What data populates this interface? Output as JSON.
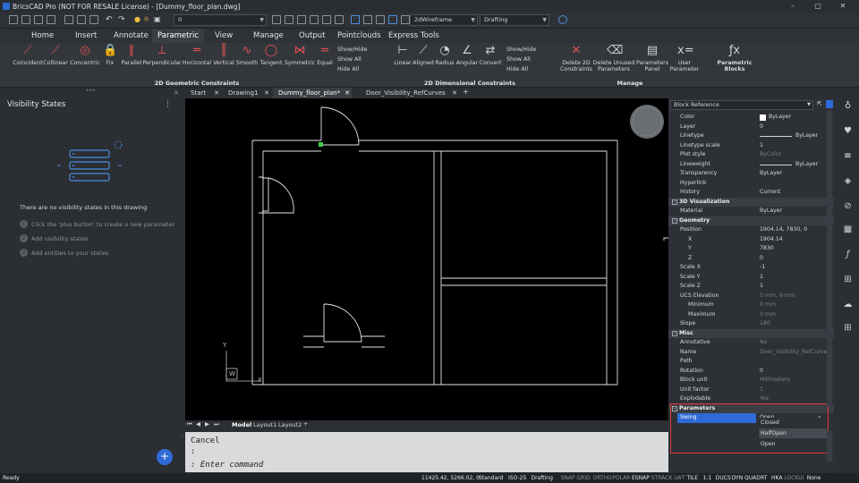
{
  "window": {
    "title": "BricsCAD Pro (NOT FOR RESALE License) - [Dummy_floor_plan.dwg]",
    "min": "–",
    "max": "▢",
    "close": "✕"
  },
  "quick": {
    "layer_value": "0",
    "visual_style": "2dWireframe",
    "workspace": "Drafting"
  },
  "menu_tabs": [
    "Home",
    "Insert",
    "Annotate",
    "Parametric",
    "View",
    "Manage",
    "Output",
    "Pointclouds",
    "Express Tools"
  ],
  "ribbon": {
    "geometric": [
      "Coincident",
      "Collinear",
      "Concentric",
      "Fix",
      "Parallel",
      "Perpendicular",
      "Horizontal",
      "Vertical",
      "Smooth",
      "Tangent",
      "Symmetric",
      "Equal"
    ],
    "geo_small": [
      "Show/Hide",
      "Show All",
      "Hide All"
    ],
    "dimensional": [
      "Linear",
      "Aligned",
      "Radius",
      "Angular",
      "Convert"
    ],
    "dim_small": [
      "Show/Hide",
      "Show All",
      "Hide All"
    ],
    "manage": [
      "Delete 2D Constraints",
      "Delete Unused Parameters",
      "Parameters Panel",
      "User Parameter"
    ],
    "blocks": "Parametric Blocks",
    "group_geo": "2D Geometric Constraints",
    "group_dim": "2D Dimensional Constraints",
    "group_manage": "Manage"
  },
  "left_panel": {
    "title": "Visibility States",
    "empty": "There are no visibility states in this drawing",
    "steps": [
      "Click the 'plus button' to create a new parameter",
      "Add visibility states",
      "Add entities to your states"
    ]
  },
  "doc_tabs": [
    "Start",
    "Drawing1",
    "Dummy_floor_plan*",
    "Door_Visibility_RefCurves"
  ],
  "layout_tabs": [
    "Model",
    "Layout1",
    "Layout2"
  ],
  "viewport": {
    "ucs_x": "X",
    "ucs_y": "Y",
    "ucs_w": "W"
  },
  "command": {
    "history": "Cancel",
    "prompt": ":",
    "input": ": Enter command"
  },
  "props": {
    "selector": "Block Reference",
    "rows": [
      {
        "k": "Color",
        "v": "ByLayer"
      },
      {
        "k": "Layer",
        "v": "0"
      },
      {
        "k": "Linetype",
        "v": "ByLayer"
      },
      {
        "k": "Linetype scale",
        "v": "1"
      },
      {
        "k": "Plot style",
        "v": "ByColor"
      },
      {
        "k": "Lineweight",
        "v": "ByLayer"
      },
      {
        "k": "Transparency",
        "v": "ByLayer"
      },
      {
        "k": "Hyperlink",
        "v": ""
      },
      {
        "k": "History",
        "v": "Current"
      },
      {
        "k": "3D Visualization",
        "v": ""
      },
      {
        "k": "Material",
        "v": "ByLayer"
      },
      {
        "k": "Geometry",
        "v": ""
      },
      {
        "k": "Position",
        "v": "1904.14, 7830, 0"
      },
      {
        "k": "X",
        "v": "1904.14"
      },
      {
        "k": "Y",
        "v": "7830"
      },
      {
        "k": "Z",
        "v": "0"
      },
      {
        "k": "Scale X",
        "v": "-1"
      },
      {
        "k": "Scale Y",
        "v": "1"
      },
      {
        "k": "Scale Z",
        "v": "1"
      },
      {
        "k": "UCS Elevation",
        "v": "0 mm, 9 mm"
      },
      {
        "k": "Minimum",
        "v": "0 mm"
      },
      {
        "k": "Maximum",
        "v": "0 mm"
      },
      {
        "k": "Slope",
        "v": "180"
      },
      {
        "k": "Misc",
        "v": ""
      },
      {
        "k": "Annotative",
        "v": "No"
      },
      {
        "k": "Name",
        "v": "Door_Visibility_RefCurves"
      },
      {
        "k": "Path",
        "v": ""
      },
      {
        "k": "Rotation",
        "v": "0"
      },
      {
        "k": "Block unit",
        "v": "Millimeters"
      },
      {
        "k": "Unit factor",
        "v": "1"
      },
      {
        "k": "Explodable",
        "v": "Yes"
      },
      {
        "k": "Parameters",
        "v": ""
      },
      {
        "k": "Swing",
        "v": "Open"
      }
    ],
    "dropdown": [
      "Closed",
      "HalfOpen",
      "Open"
    ]
  },
  "status": {
    "ready": "Ready",
    "coords": "11425.42, 5266.02, 0",
    "toggles": [
      "Standard",
      "ISO-25",
      "Drafting",
      "SNAP",
      "GRID",
      "ORTHO",
      "POLAR",
      "ESNAP",
      "STRACK",
      "LWT",
      "TILE",
      "1:1",
      "DUCS",
      "DYN",
      "QUAD",
      "RT",
      "HKA",
      "LOCKUI",
      "None"
    ]
  },
  "colors": {
    "accent": "#2f6bd6",
    "highlight": "#e03a3a",
    "grip": "#3fd24b"
  }
}
